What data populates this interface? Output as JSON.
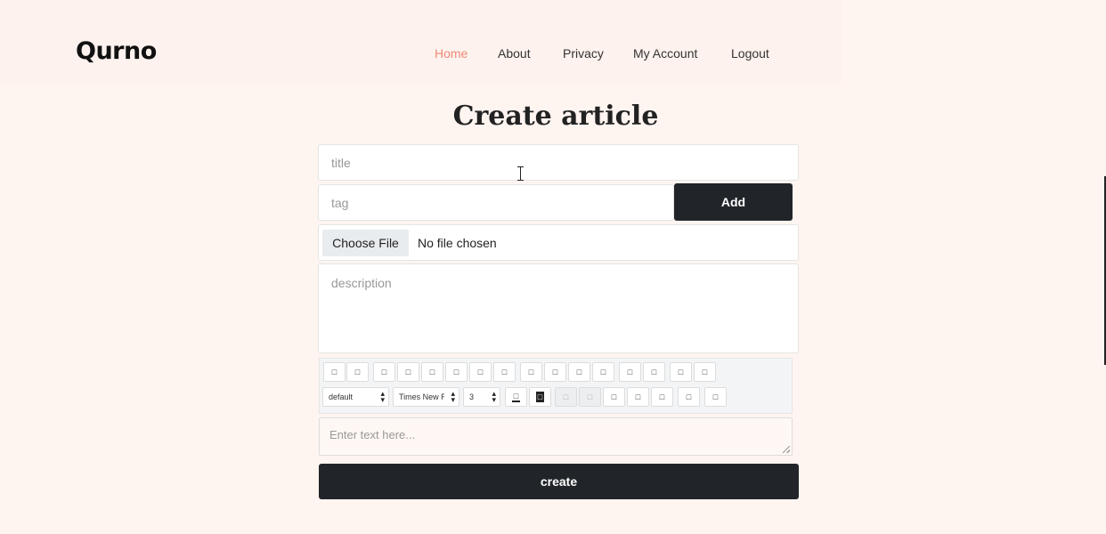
{
  "brand": "Qurno",
  "nav": {
    "items": [
      {
        "label": "Home",
        "active": true
      },
      {
        "label": "About"
      },
      {
        "label": "Privacy"
      },
      {
        "label": "My Account"
      },
      {
        "label": "Logout"
      }
    ]
  },
  "page_title": "Create article",
  "form": {
    "title_placeholder": "title",
    "tag_placeholder": "tag",
    "add_button": "Add",
    "choose_file_button": "Choose File",
    "file_status": "No file chosen",
    "description_placeholder": "description",
    "editor_placeholder": "Enter text here...",
    "create_button": "create"
  },
  "toolbar": {
    "row1_icons": [
      "bold-icon",
      "italic-icon",
      "underline-icon",
      "strikethrough-icon",
      "superscript-icon",
      "subscript-icon",
      "ordered-list-icon",
      "unordered-list-icon",
      "align-left-icon",
      "align-center-icon",
      "align-right-icon",
      "align-justify-icon",
      "indent-icon",
      "outdent-icon",
      "link-icon",
      "unlink-icon"
    ],
    "format_select": "default",
    "font_select": "Times New Roman",
    "size_select": "3",
    "row2_icons": [
      "font-color-icon",
      "highlight-color-icon",
      "undo-icon",
      "redo-icon",
      "image-icon",
      "table-icon",
      "code-icon",
      "clear-format-icon",
      "fullscreen-icon"
    ]
  },
  "colors": {
    "background": "#fef4f0",
    "accent": "#f08a76",
    "dark": "#212529"
  }
}
